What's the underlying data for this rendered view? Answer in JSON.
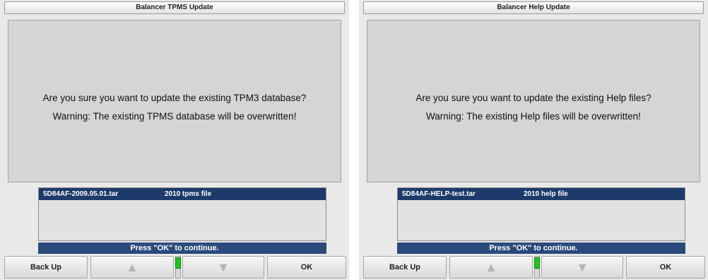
{
  "screens": [
    {
      "title": "Balancer TPMS Update",
      "message_line1": "Are you sure you want to update the existing TPM3 database?",
      "message_line2": "Warning: The existing TPMS database will be overwritten!",
      "file": {
        "name": "5D84AF-2009.05.01.tar",
        "description": "2010 tpms file"
      },
      "hint": "Press \"OK\" to continue.",
      "buttons": {
        "back": "Back Up",
        "ok": "OK"
      },
      "scroll_fraction": 0.0
    },
    {
      "title": "Balancer Help Update",
      "message_line1": "Are you sure you want to update the existing Help files?",
      "message_line2": "Warning: The existing Help files will be overwritten!",
      "file": {
        "name": "5D84AF-HELP-test.tar",
        "description": "2010 help file"
      },
      "hint": "Press \"OK\" to continue.",
      "buttons": {
        "back": "Back Up",
        "ok": "OK"
      },
      "scroll_fraction": 0.0
    }
  ],
  "icons": {
    "up": "arrow-up-icon",
    "down": "arrow-down-icon"
  },
  "colors": {
    "selection": "#1d3a6b",
    "scroll_thumb": "#22c322",
    "background": "#d5d5d5"
  }
}
